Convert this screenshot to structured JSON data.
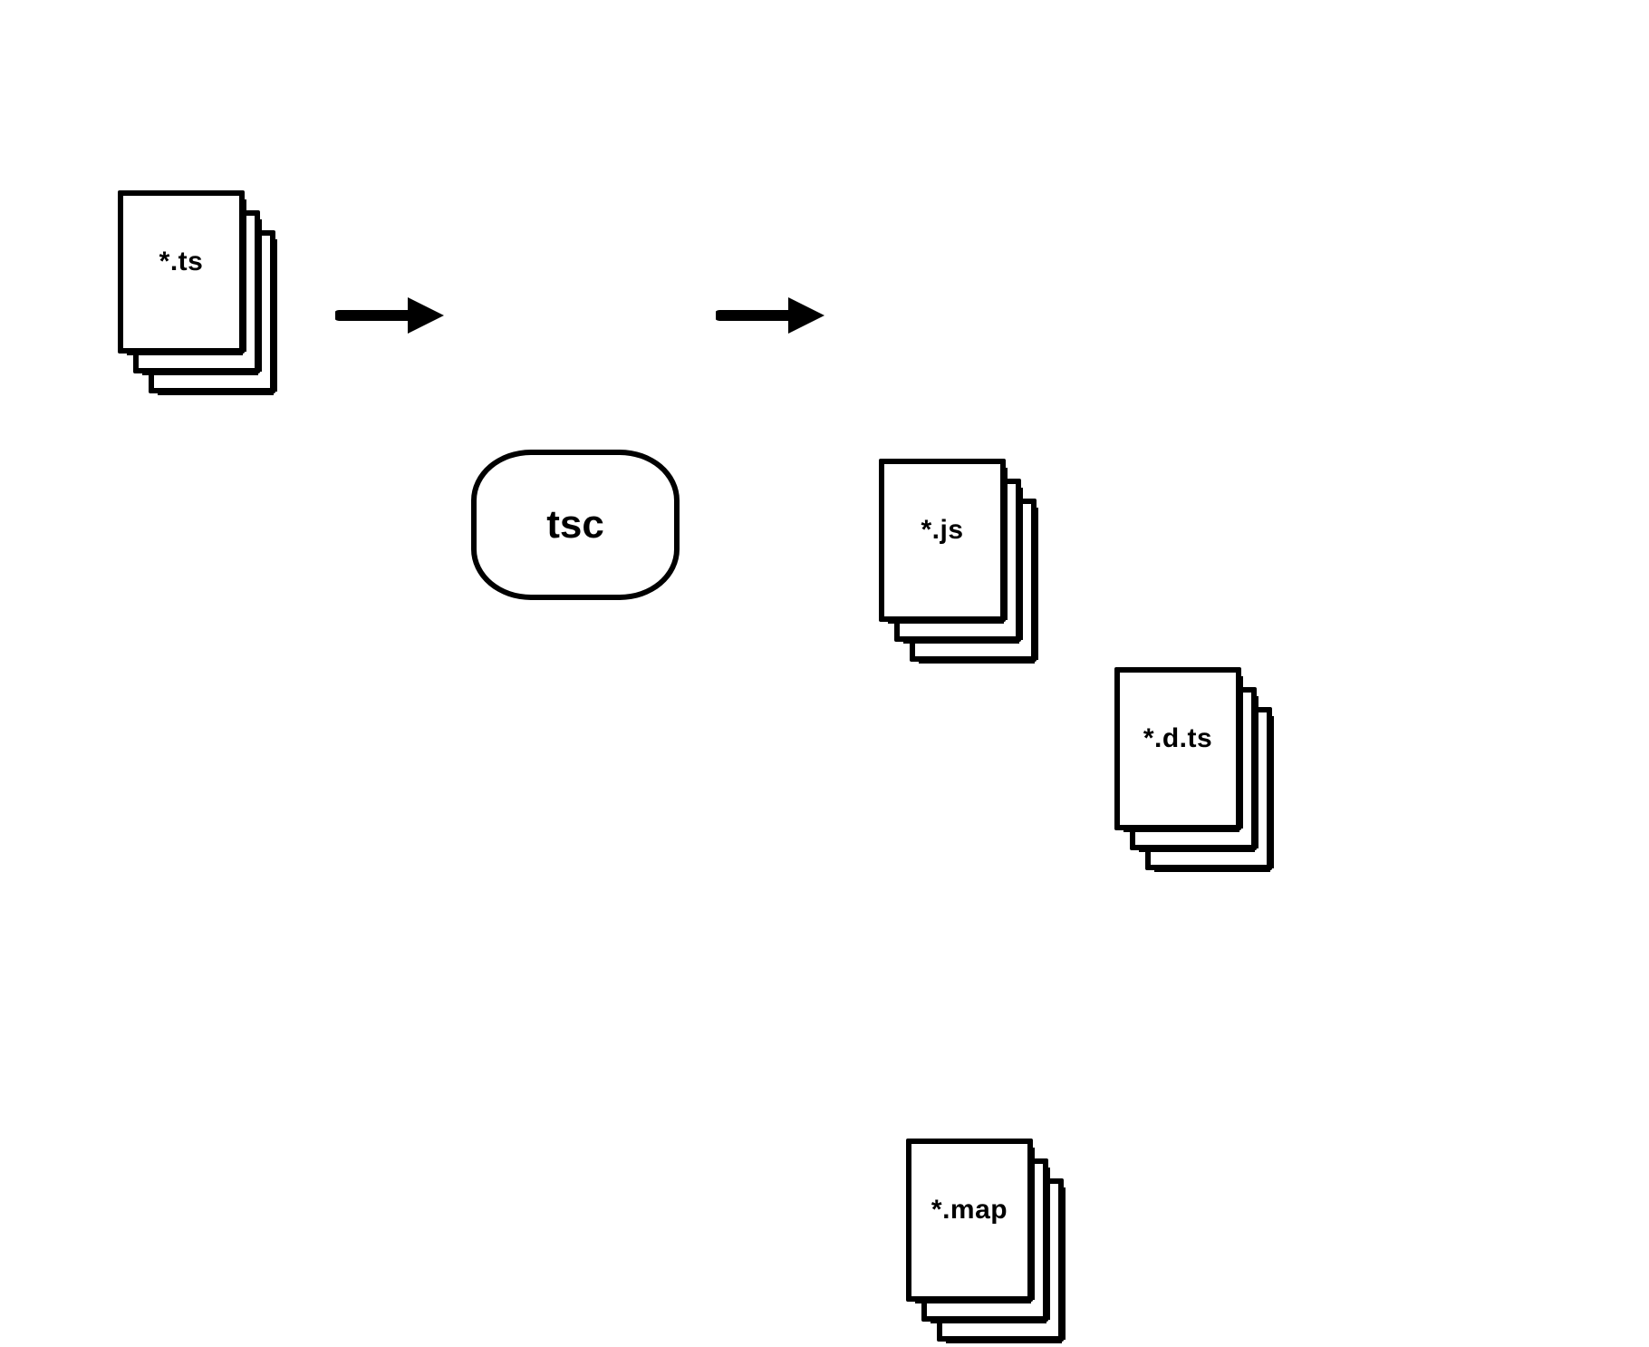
{
  "compiler": {
    "name": "tsc"
  },
  "input": {
    "label": "*.ts"
  },
  "outputs": {
    "js": {
      "label": "*.js"
    },
    "dts": {
      "label": "*.d.ts"
    },
    "map": {
      "label": "*.map"
    }
  }
}
